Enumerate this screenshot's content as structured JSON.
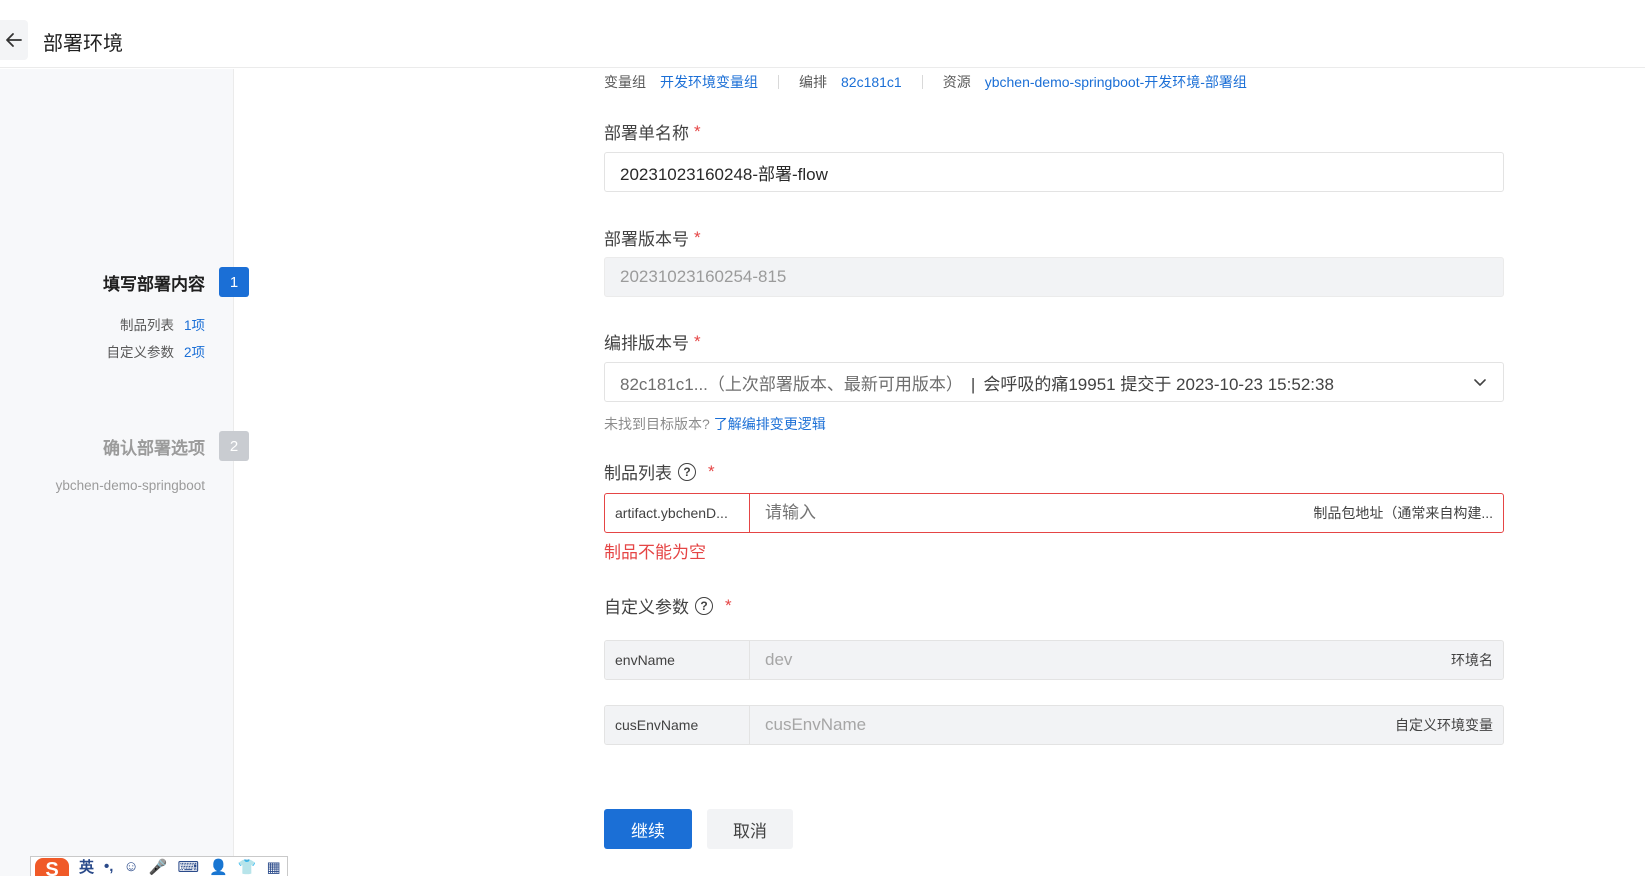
{
  "header": {
    "title": "部署环境"
  },
  "sidebar": {
    "steps": [
      {
        "title": "填写部署内容",
        "number": "1",
        "subs": [
          {
            "label": "制品列表",
            "count": "1项"
          },
          {
            "label": "自定义参数",
            "count": "2项"
          }
        ]
      },
      {
        "title": "确认部署选项",
        "number": "2",
        "subs": [
          {
            "label": "ybchen-demo-springboot"
          }
        ]
      }
    ]
  },
  "meta": {
    "vargroup_key": "变量组",
    "vargroup_value": "开发环境变量组",
    "orchestration_key": "编排",
    "orchestration_value": "82c181c1",
    "resource_key": "资源",
    "resource_value": "ybchen-demo-springboot-开发环境-部署组"
  },
  "form": {
    "deploy_name": {
      "label": "部署单名称",
      "value": "20231023160248-部署-flow"
    },
    "deploy_version": {
      "label": "部署版本号",
      "value": "20231023160254-815"
    },
    "orch_version": {
      "label": "编排版本号",
      "value_muted": "82c181c1...（上次部署版本、最新可用版本）",
      "separator": "|",
      "value_main": "会呼吸的痛19951 提交于 2023-10-23 15:52:38",
      "hint": "未找到目标版本?",
      "hint_link": "了解编排变更逻辑"
    },
    "artifacts": {
      "label": "制品列表",
      "key": "artifact.ybchenD...",
      "placeholder": "请输入",
      "desc": "制品包地址（通常来自构建...",
      "error": "制品不能为空"
    },
    "custom_params": {
      "label": "自定义参数",
      "rows": [
        {
          "key": "envName",
          "value": "dev",
          "desc": "环境名"
        },
        {
          "key": "cusEnvName",
          "value": "cusEnvName",
          "desc": "自定义环境变量"
        }
      ]
    },
    "required_mark": "*",
    "help_mark": "?"
  },
  "actions": {
    "continue_label": "继续",
    "cancel_label": "取消"
  },
  "ime": {
    "logo": "S",
    "lang": "英",
    "punct": "•,",
    "emoji": "☺",
    "voice": "🎤",
    "keyboard": "⌨",
    "user": "👤",
    "skin": "👕",
    "grid": "▦"
  },
  "colors": {
    "primary": "#1b6fd6",
    "error": "#e54545",
    "sidebar_bg": "#f7f8fa"
  }
}
